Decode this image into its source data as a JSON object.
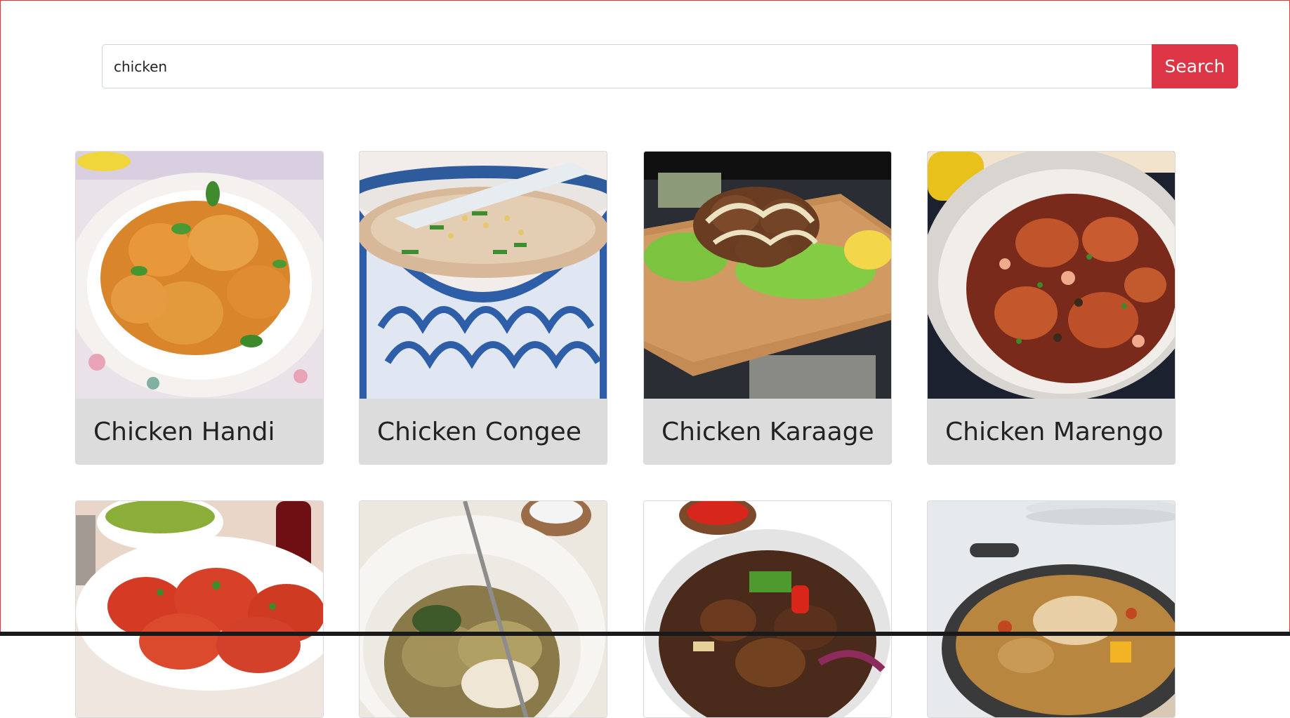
{
  "search": {
    "value": "chicken",
    "placeholder": "",
    "button_label": "Search"
  },
  "recipes": [
    {
      "title": "Chicken Handi"
    },
    {
      "title": "Chicken Congee"
    },
    {
      "title": "Chicken Karaage"
    },
    {
      "title": "Chicken Marengo"
    },
    {
      "title": ""
    },
    {
      "title": ""
    },
    {
      "title": ""
    },
    {
      "title": ""
    }
  ],
  "colors": {
    "accent": "#dc3545",
    "card_title_bg": "#dcdcdc",
    "frame": "#e03a3a"
  },
  "icons": []
}
